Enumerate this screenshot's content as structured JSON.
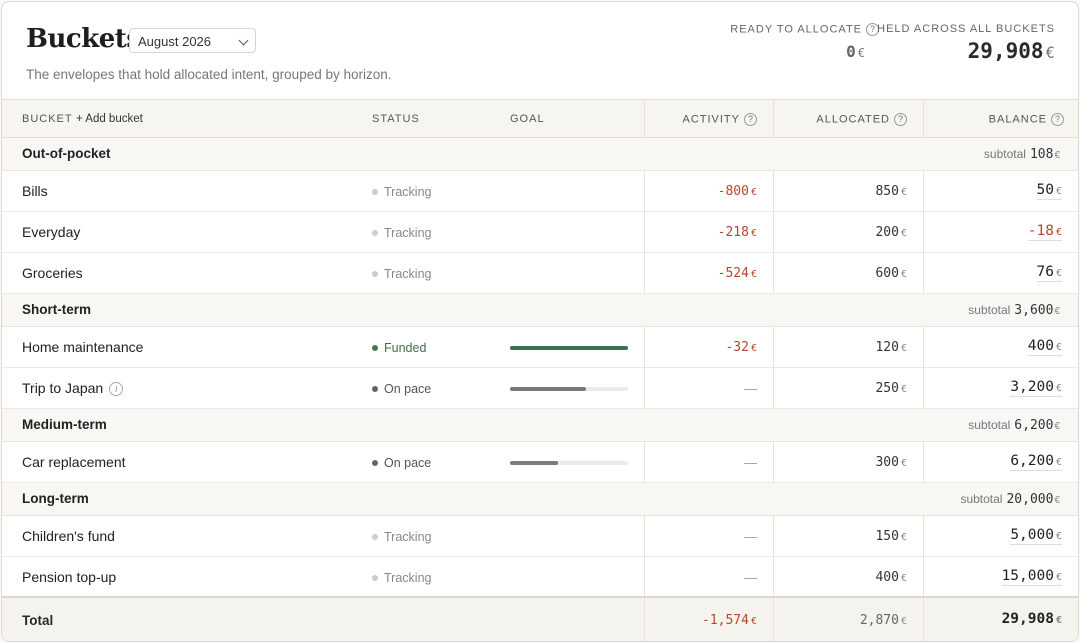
{
  "header": {
    "title": "Buckets",
    "month": "August 2026",
    "subtitle": "The envelopes that hold allocated intent, grouped by horizon.",
    "ready_label": "READY TO ALLOCATE",
    "ready_value": "0",
    "held_label": "HELD ACROSS ALL BUCKETS",
    "held_value": "29,908",
    "currency": "€"
  },
  "columns": {
    "bucket": "BUCKET",
    "add_bucket": "+ Add bucket",
    "status": "STATUS",
    "goal": "GOAL",
    "activity": "ACTIVITY",
    "allocated": "ALLOCATED",
    "balance": "BALANCE"
  },
  "subtotal_label": "subtotal",
  "groups": [
    {
      "name": "Out-of-pocket",
      "subtotal": "108"
    },
    {
      "name": "Short-term",
      "subtotal": "3,600"
    },
    {
      "name": "Medium-term",
      "subtotal": "6,200"
    },
    {
      "name": "Long-term",
      "subtotal": "20,000"
    }
  ],
  "rows": [
    {
      "name": "Bills",
      "status": "Tracking",
      "activity": "-800",
      "allocated": "850",
      "balance": "50"
    },
    {
      "name": "Everyday",
      "status": "Tracking",
      "activity": "-218",
      "allocated": "200",
      "balance": "-18"
    },
    {
      "name": "Groceries",
      "status": "Tracking",
      "activity": "-524",
      "allocated": "600",
      "balance": "76"
    },
    {
      "name": "Home maintenance",
      "status": "Funded",
      "goal_progress": 1.0,
      "activity": "-32",
      "allocated": "120",
      "balance": "400"
    },
    {
      "name": "Trip to Japan",
      "status": "On pace",
      "goal_progress": 0.64,
      "activity": "—",
      "allocated": "250",
      "balance": "3,200"
    },
    {
      "name": "Car replacement",
      "status": "On pace",
      "goal_progress": 0.41,
      "activity": "—",
      "allocated": "300",
      "balance": "6,200"
    },
    {
      "name": "Children's fund",
      "status": "Tracking",
      "activity": "—",
      "allocated": "150",
      "balance": "5,000"
    },
    {
      "name": "Pension top-up",
      "status": "Tracking",
      "activity": "—",
      "allocated": "400",
      "balance": "15,000"
    }
  ],
  "total": {
    "label": "Total",
    "activity": "-1,574",
    "allocated": "2,870",
    "balance": "29,908"
  },
  "colors": {
    "negative": "#b5472f",
    "funded": "#3d7250",
    "on_pace": "#7a7a7a"
  }
}
